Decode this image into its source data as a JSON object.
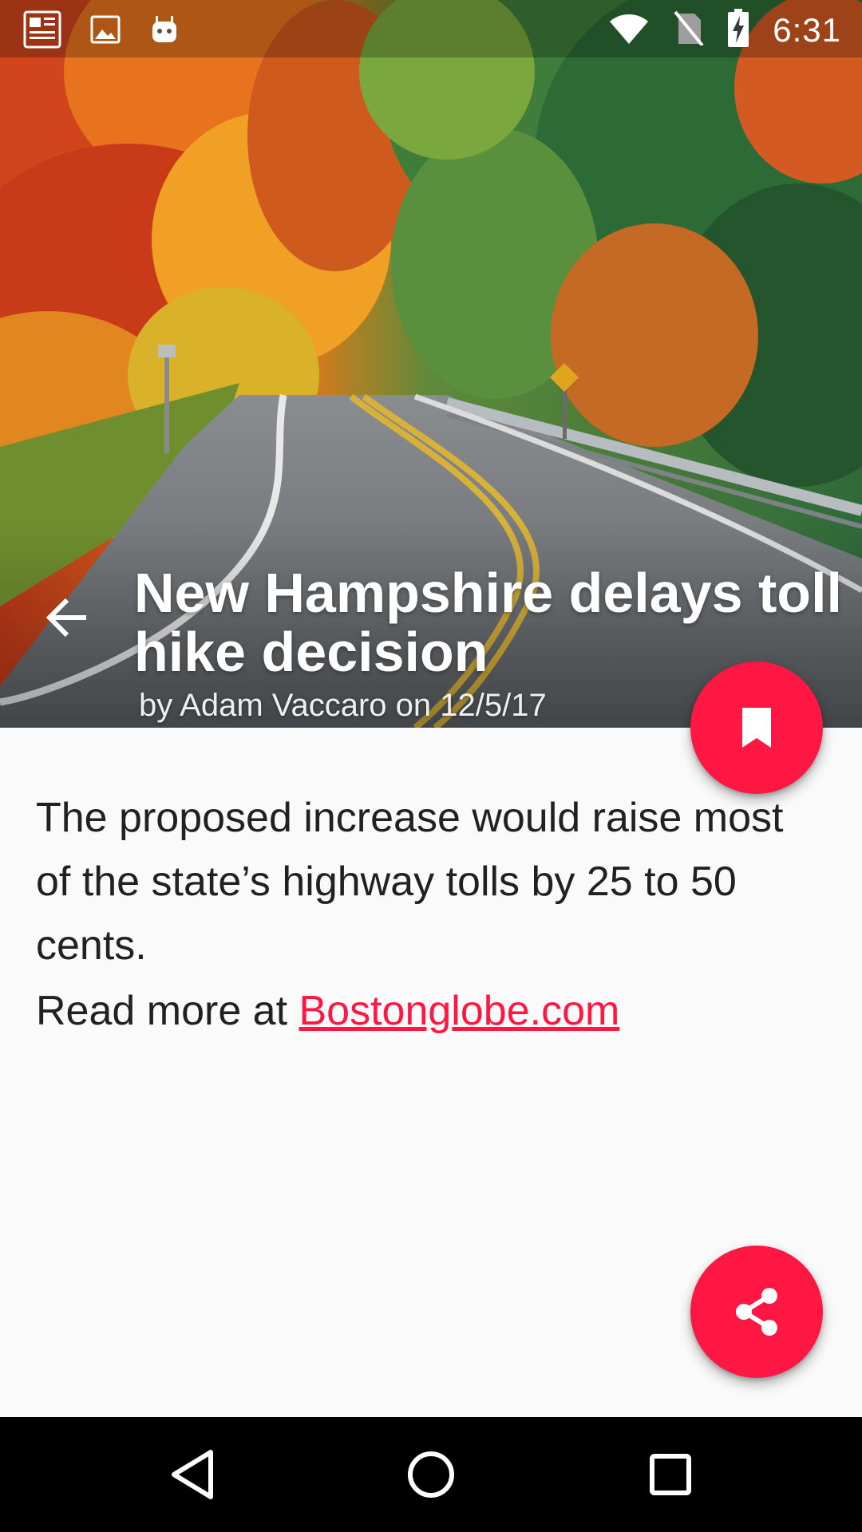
{
  "status_bar": {
    "time": "6:31",
    "left_icons": [
      "news-icon",
      "image-icon",
      "android-icon"
    ],
    "right_icons": [
      "wifi-icon",
      "no-sim-icon",
      "battery-charging-icon"
    ]
  },
  "hero": {
    "image_icon": "autumn-road-photo"
  },
  "article": {
    "title": "New Hampshire delays toll hike decision",
    "byline": "by Adam Vaccaro on 12/5/17",
    "summary": "The proposed increase would raise most of the state’s highway tolls by 25 to 50 cents.",
    "read_more_prefix": "Read more at ",
    "source_link": "Bostonglobe.com"
  },
  "actions": {
    "back_icon": "arrow-back-icon",
    "bookmark_icon": "bookmark-icon",
    "share_icon": "share-icon"
  },
  "nav_bar": {
    "buttons": [
      "nav-back-icon",
      "nav-home-icon",
      "nav-recents-icon"
    ]
  },
  "colors": {
    "accent": "#ff1744",
    "body_text": "#212121",
    "background": "#fafafa",
    "nav_bar": "#000000"
  }
}
